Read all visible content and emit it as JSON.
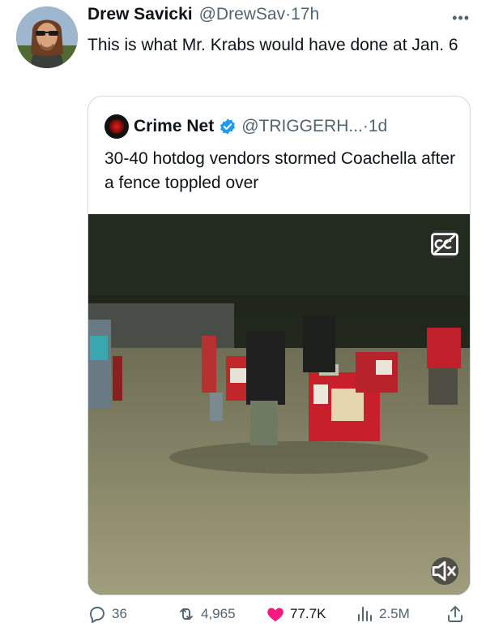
{
  "author": {
    "display_name": "Drew Savicki",
    "handle": "@DrewSav",
    "separator": "·",
    "time": "17h",
    "more_icon": "more-icon"
  },
  "tweet": {
    "text": "This is what Mr. Krabs would have done at Jan. 6"
  },
  "quote": {
    "display_name": "Crime Net",
    "handle": "@TRIGGERH...",
    "separator": "·",
    "time": "1d",
    "verified_icon": "verified-badge-icon",
    "text": "30-40 hotdog vendors stormed Coachella after a fence toppled over",
    "media": {
      "cc_icon": "closed-captions-icon",
      "mute_icon": "muted-speaker-icon"
    }
  },
  "actions": {
    "replies": "36",
    "reposts": "4,965",
    "likes": "77.7K",
    "views": "2.5M",
    "share_icon": "share-icon"
  },
  "colors": {
    "text_primary": "#0f1419",
    "text_secondary": "#536471",
    "verified": "#1d9bf0",
    "like": "#f91880",
    "border": "#cfd9de"
  }
}
